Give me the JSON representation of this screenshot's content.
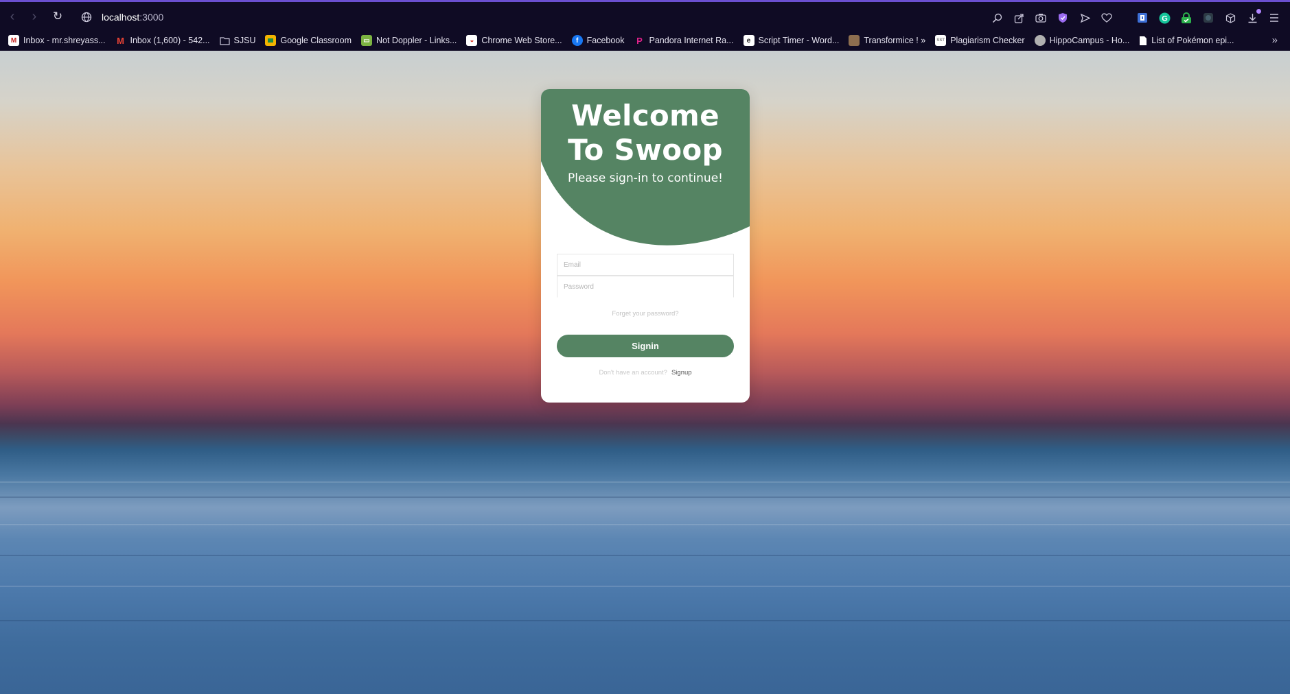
{
  "browser": {
    "url_host": "localhost",
    "url_port": ":3000",
    "accent": "#6a4fd0"
  },
  "nav": {
    "back_icon": "chevron-left-icon",
    "forward_icon": "chevron-right-icon",
    "reload_icon": "reload-icon",
    "site_icon": "globe-icon"
  },
  "bookmarks": [
    {
      "label": "Inbox - mr.shreyass...",
      "icon": "gmail-icon",
      "color": "#c5221f"
    },
    {
      "label": "Inbox (1,600) - 542...",
      "icon": "gmail-icon",
      "color": "#ea4335"
    },
    {
      "label": "SJSU",
      "icon": "folder-icon",
      "color": "#c9c6d9"
    },
    {
      "label": "Google Classroom",
      "icon": "classroom-icon",
      "color": "#f4b400"
    },
    {
      "label": "Not Doppler - Links...",
      "icon": "notdoppler-icon",
      "color": "#7cb342"
    },
    {
      "label": "Chrome Web Store...",
      "icon": "webstore-icon",
      "color": "#db4437"
    },
    {
      "label": "Facebook",
      "icon": "facebook-icon",
      "color": "#1877f2"
    },
    {
      "label": "Pandora Internet Ra...",
      "icon": "pandora-icon",
      "color": "#e0218a"
    },
    {
      "label": "Script Timer - Word...",
      "icon": "scripttimer-icon",
      "color": "#ffffff"
    },
    {
      "label": "Transformice ! »",
      "icon": "transformice-icon",
      "color": "#8d6e4f"
    },
    {
      "label": "Plagiarism Checker",
      "icon": "sst-icon",
      "color": "#ffffff"
    },
    {
      "label": "HippoCampus - Ho...",
      "icon": "hippocampus-icon",
      "color": "#b0b0b0"
    },
    {
      "label": "List of Pokémon epi...",
      "icon": "document-icon",
      "color": "#ffffff"
    }
  ],
  "toolbar": {
    "icons": [
      "zoom-icon",
      "share-icon",
      "camera-icon",
      "vpn-shield-icon",
      "send-icon",
      "heart-icon",
      "extension-icon",
      "grammarly-icon",
      "password-manager-icon",
      "extension-dark-icon",
      "cube-icon",
      "download-icon",
      "menu-icon"
    ]
  },
  "login": {
    "title_line1": "Welcome",
    "title_line2": "To Swoop",
    "subtitle": "Please sign-in to continue!",
    "email_placeholder": "Email",
    "password_placeholder": "Password",
    "forgot": "Forget your password?",
    "signin": "Signin",
    "signup_question": "Don't have an account?",
    "signup": "Signup",
    "accent": "#558463"
  }
}
